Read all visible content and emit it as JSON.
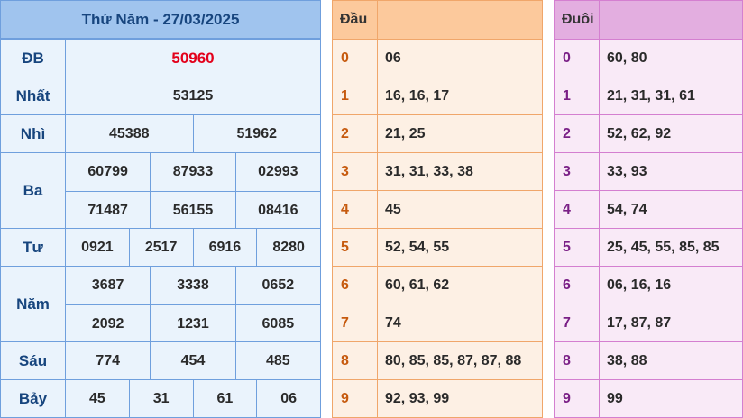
{
  "title": "Thứ Năm - 27/03/2025",
  "prizes": [
    {
      "label": "ĐB",
      "lines": [
        [
          "50960"
        ]
      ],
      "highlight": true
    },
    {
      "label": "Nhất",
      "lines": [
        [
          "53125"
        ]
      ]
    },
    {
      "label": "Nhì",
      "lines": [
        [
          "45388",
          "51962"
        ]
      ]
    },
    {
      "label": "Ba",
      "lines": [
        [
          "60799",
          "87933",
          "02993"
        ],
        [
          "71487",
          "56155",
          "08416"
        ]
      ]
    },
    {
      "label": "Tư",
      "lines": [
        [
          "0921",
          "2517",
          "6916",
          "8280"
        ]
      ]
    },
    {
      "label": "Năm",
      "lines": [
        [
          "3687",
          "3338",
          "0652"
        ],
        [
          "2092",
          "1231",
          "6085"
        ]
      ]
    },
    {
      "label": "Sáu",
      "lines": [
        [
          "774",
          "454",
          "485"
        ]
      ]
    },
    {
      "label": "Bảy",
      "lines": [
        [
          "45",
          "31",
          "61",
          "06"
        ]
      ]
    }
  ],
  "dau": {
    "header": "Đầu",
    "rows": [
      {
        "k": "0",
        "v": "06"
      },
      {
        "k": "1",
        "v": "16, 16, 17"
      },
      {
        "k": "2",
        "v": "21, 25"
      },
      {
        "k": "3",
        "v": "31, 31, 33, 38"
      },
      {
        "k": "4",
        "v": "45"
      },
      {
        "k": "5",
        "v": "52, 54, 55"
      },
      {
        "k": "6",
        "v": "60, 61, 62"
      },
      {
        "k": "7",
        "v": "74"
      },
      {
        "k": "8",
        "v": "80, 85, 85, 87, 87, 88"
      },
      {
        "k": "9",
        "v": "92, 93, 99"
      }
    ]
  },
  "duoi": {
    "header": "Đuôi",
    "rows": [
      {
        "k": "0",
        "v": "60, 80"
      },
      {
        "k": "1",
        "v": "21, 31, 31, 61"
      },
      {
        "k": "2",
        "v": "52, 62, 92"
      },
      {
        "k": "3",
        "v": "33, 93"
      },
      {
        "k": "4",
        "v": "54, 74"
      },
      {
        "k": "5",
        "v": "25, 45, 55, 85, 85"
      },
      {
        "k": "6",
        "v": "06, 16, 16"
      },
      {
        "k": "7",
        "v": "17, 87, 87"
      },
      {
        "k": "8",
        "v": "38, 88"
      },
      {
        "k": "9",
        "v": "99"
      }
    ]
  }
}
